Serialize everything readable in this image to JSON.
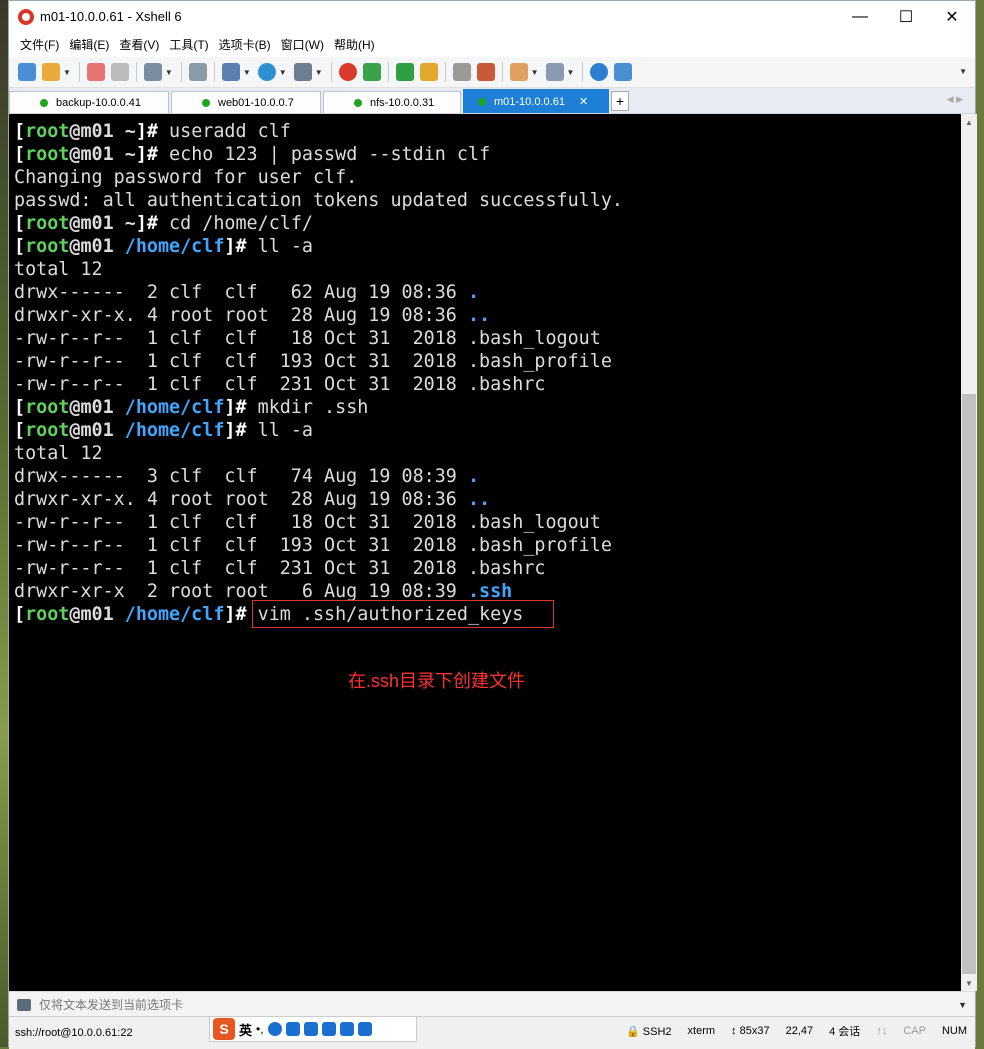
{
  "window": {
    "title": "m01-10.0.0.61 - Xshell 6"
  },
  "menu": [
    "文件(F)",
    "编辑(E)",
    "查看(V)",
    "工具(T)",
    "选项卡(B)",
    "窗口(W)",
    "帮助(H)"
  ],
  "tabs": [
    {
      "label": "backup-10.0.0.41",
      "active": false
    },
    {
      "label": "web01-10.0.0.7",
      "active": false
    },
    {
      "label": "nfs-10.0.0.31",
      "active": false
    },
    {
      "label": "m01-10.0.0.61",
      "active": true
    }
  ],
  "terminal": {
    "prompt_user": "root",
    "prompt_host": "m01",
    "lines": [
      {
        "type": "prompt",
        "dir": "~",
        "cmd": "useradd clf"
      },
      {
        "type": "prompt",
        "dir": "~",
        "cmd": "echo 123 | passwd --stdin clf"
      },
      {
        "type": "out",
        "text": "Changing password for user clf."
      },
      {
        "type": "out",
        "text": "passwd: all authentication tokens updated successfully."
      },
      {
        "type": "prompt",
        "dir": "~",
        "cmd": "cd /home/clf/"
      },
      {
        "type": "prompt",
        "dir": "/home/clf",
        "cmd": "ll -a"
      },
      {
        "type": "out",
        "text": "total 12"
      },
      {
        "type": "ls",
        "text": "drwx------  2 clf  clf   62 Aug 19 08:36 ",
        "name": "."
      },
      {
        "type": "ls",
        "text": "drwxr-xr-x. 4 root root  28 Aug 19 08:36 ",
        "name": ".."
      },
      {
        "type": "out",
        "text": "-rw-r--r--  1 clf  clf   18 Oct 31  2018 .bash_logout"
      },
      {
        "type": "out",
        "text": "-rw-r--r--  1 clf  clf  193 Oct 31  2018 .bash_profile"
      },
      {
        "type": "out",
        "text": "-rw-r--r--  1 clf  clf  231 Oct 31  2018 .bashrc"
      },
      {
        "type": "prompt",
        "dir": "/home/clf",
        "cmd": "mkdir .ssh"
      },
      {
        "type": "prompt",
        "dir": "/home/clf",
        "cmd": "ll -a"
      },
      {
        "type": "out",
        "text": "total 12"
      },
      {
        "type": "ls",
        "text": "drwx------  3 clf  clf   74 Aug 19 08:39 ",
        "name": "."
      },
      {
        "type": "ls",
        "text": "drwxr-xr-x. 4 root root  28 Aug 19 08:36 ",
        "name": ".."
      },
      {
        "type": "out",
        "text": "-rw-r--r--  1 clf  clf   18 Oct 31  2018 .bash_logout"
      },
      {
        "type": "out",
        "text": "-rw-r--r--  1 clf  clf  193 Oct 31  2018 .bash_profile"
      },
      {
        "type": "out",
        "text": "-rw-r--r--  1 clf  clf  231 Oct 31  2018 .bashrc"
      },
      {
        "type": "ls",
        "text": "drwxr-xr-x  2 root root   6 Aug 19 08:39 ",
        "name": ".ssh"
      },
      {
        "type": "prompt",
        "dir": "/home/clf",
        "cmd": "vim .ssh/authorized_keys"
      }
    ]
  },
  "annotation": "在.ssh目录下创建文件",
  "compose": {
    "placeholder": "仅将文本发送到当前选项卡"
  },
  "status": {
    "connection": "ssh://root@10.0.0.61:22",
    "ime_label": "英",
    "protocol": "SSH2",
    "term": "xterm",
    "size": "85x37",
    "cursor": "22,47",
    "sessions": "4 会话",
    "caps": "CAP",
    "num": "NUM"
  },
  "colors": {
    "prompt_user": "#5dd35d",
    "prompt_dir": "#3fa7ff",
    "active_tab": "#1e7fd6",
    "annotation": "#ff3030"
  }
}
